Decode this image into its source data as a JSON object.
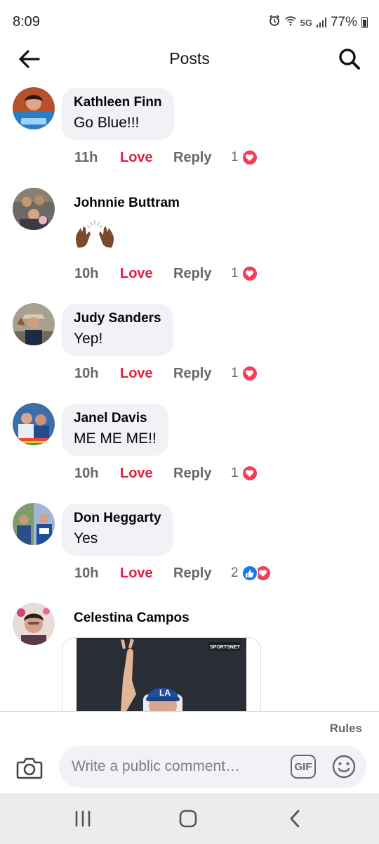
{
  "status_bar": {
    "time": "8:09",
    "network": "5G",
    "battery": "77%",
    "icons": [
      "alarm-icon",
      "wifi-icon",
      "signal-icon",
      "battery-icon"
    ]
  },
  "header": {
    "title": "Posts",
    "back_icon": "arrow-left-icon",
    "search_icon": "search-icon"
  },
  "actions": {
    "love_label": "Love",
    "reply_label": "Reply"
  },
  "comments": [
    {
      "author": "Kathleen Finn",
      "text": "Go Blue!!!",
      "time": "11h",
      "reaction_count": "1",
      "reactions": [
        "heart"
      ]
    },
    {
      "author": "Johnnie Buttram",
      "text": "",
      "emoji": "raising-hands-emoji",
      "time": "10h",
      "reaction_count": "1",
      "reactions": [
        "heart"
      ]
    },
    {
      "author": "Judy Sanders",
      "text": "Yep!",
      "time": "10h",
      "reaction_count": "1",
      "reactions": [
        "heart"
      ]
    },
    {
      "author": "Janel Davis",
      "text": "ME ME ME!!",
      "time": "10h",
      "reaction_count": "1",
      "reactions": [
        "heart"
      ]
    },
    {
      "author": "Don Heggarty",
      "text": "Yes",
      "time": "10h",
      "reaction_count": "2",
      "reactions": [
        "like",
        "heart"
      ]
    },
    {
      "author": "Celestina Campos",
      "text": "",
      "media": "photo"
    }
  ],
  "media": {
    "badge": "SPORTSNET"
  },
  "footer": {
    "rules": "Rules",
    "comment_placeholder": "Write a public comment…",
    "gif_label": "GIF"
  },
  "colors": {
    "love": "#e41e3f",
    "heart_reaction": "#f33e58",
    "like_reaction": "#1877f2",
    "bubble": "#f0f2f5",
    "secondary_text": "#65676b"
  },
  "navbar": {
    "buttons": [
      "recent-apps-icon",
      "home-icon",
      "back-icon"
    ]
  }
}
